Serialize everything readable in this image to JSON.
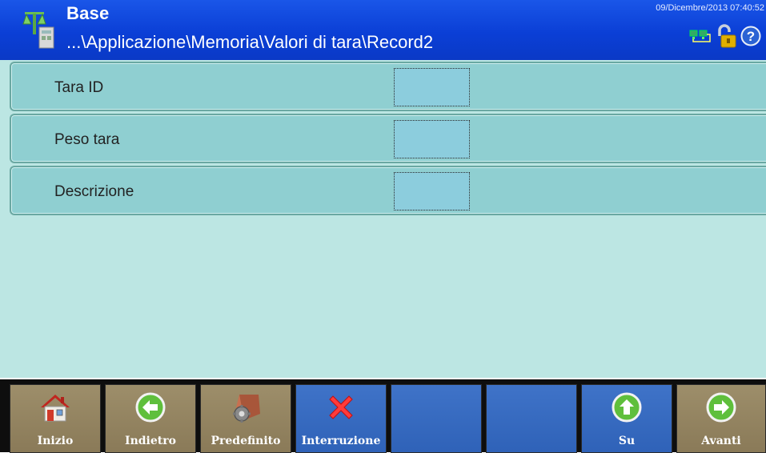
{
  "header": {
    "title": "Base",
    "path": "...\\Applicazione\\Memoria\\Valori di tara\\Record2",
    "datetime": "09/Dicembre/2013 07:40:52",
    "icons": [
      "scale-icon",
      "network-icon",
      "unlocked-padlock-icon",
      "help-icon"
    ]
  },
  "fields": [
    {
      "label": "Tara ID",
      "value": ""
    },
    {
      "label": "Peso tara",
      "value": ""
    },
    {
      "label": "Descrizione",
      "value": ""
    }
  ],
  "softkeys": [
    {
      "label": "Inizio",
      "icon": "home-icon"
    },
    {
      "label": "Indietro",
      "icon": "back-arrow-icon"
    },
    {
      "label": "Predefinito",
      "icon": "default-settings-icon"
    },
    {
      "label": "Interruzione",
      "icon": "cancel-x-icon"
    },
    {
      "label": "",
      "icon": ""
    },
    {
      "label": "",
      "icon": ""
    },
    {
      "label": "Su",
      "icon": "up-arrow-icon"
    },
    {
      "label": "Avanti",
      "icon": "forward-arrow-icon"
    }
  ],
  "colors": {
    "header_bg": "#0b3fd6",
    "content_bg": "#bce6e3",
    "row_bg": "#8fcfd1",
    "softkey_brown": "#8a7a58",
    "softkey_blue": "#2f62b8"
  }
}
